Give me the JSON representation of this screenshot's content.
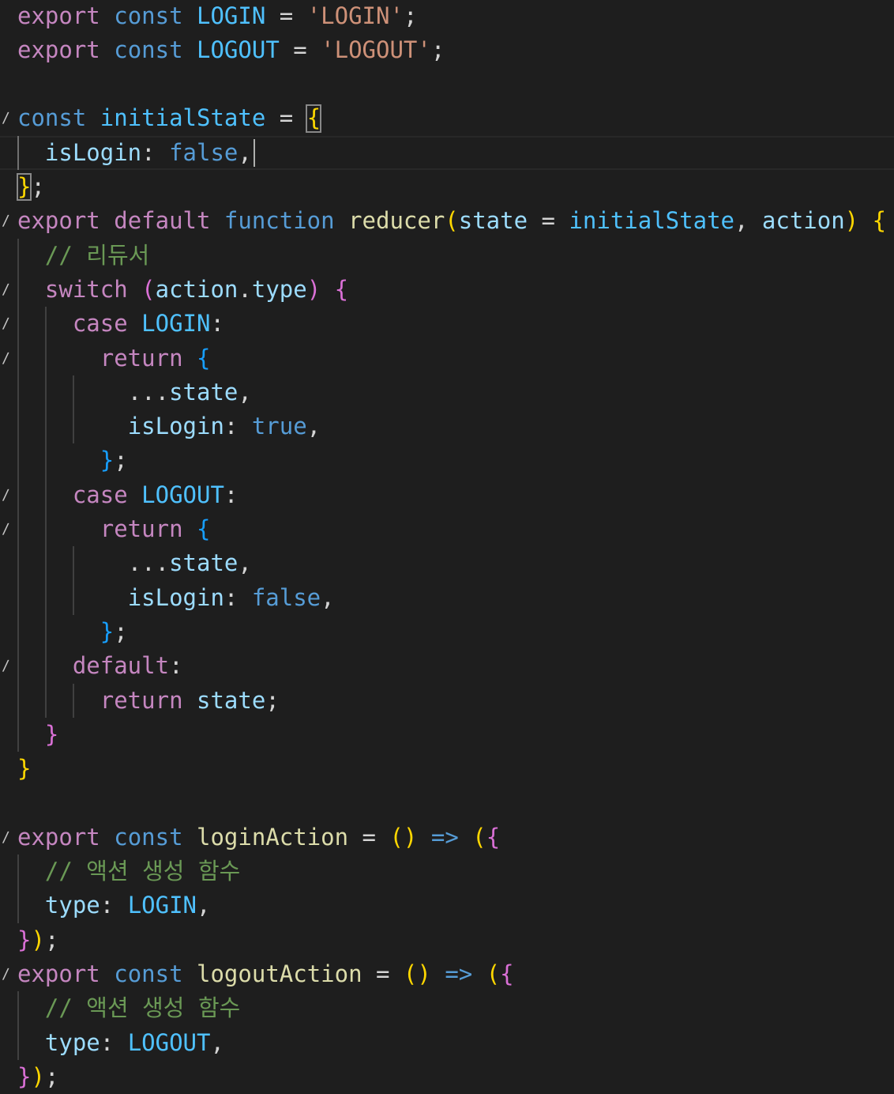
{
  "editor": {
    "theme_colors": {
      "background": "#1e1e1e",
      "keyword": "#569cd6",
      "control": "#c586c0",
      "variable": "#9cdcfe",
      "constant": "#4fc1ff",
      "function": "#dcdcaa",
      "string": "#ce9178",
      "comment": "#6a9955",
      "bracket_level_1": "#ffd700",
      "bracket_level_2": "#da70d6",
      "bracket_level_3": "#179fff"
    },
    "lines": [
      {
        "fold": false,
        "tokens": [
          {
            "t": "export",
            "c": "t-ctl"
          },
          {
            "t": " ",
            "c": ""
          },
          {
            "t": "const",
            "c": "t-kw"
          },
          {
            "t": " ",
            "c": ""
          },
          {
            "t": "LOGIN",
            "c": "t-const"
          },
          {
            "t": " = ",
            "c": ""
          },
          {
            "t": "'LOGIN'",
            "c": "t-str"
          },
          {
            "t": ";",
            "c": ""
          }
        ]
      },
      {
        "fold": false,
        "tokens": [
          {
            "t": "export",
            "c": "t-ctl"
          },
          {
            "t": " ",
            "c": ""
          },
          {
            "t": "const",
            "c": "t-kw"
          },
          {
            "t": " ",
            "c": ""
          },
          {
            "t": "LOGOUT",
            "c": "t-const"
          },
          {
            "t": " = ",
            "c": ""
          },
          {
            "t": "'LOGOUT'",
            "c": "t-str"
          },
          {
            "t": ";",
            "c": ""
          }
        ]
      },
      {
        "fold": false,
        "tokens": []
      },
      {
        "fold": true,
        "tokens": [
          {
            "t": "const",
            "c": "t-kw"
          },
          {
            "t": " ",
            "c": ""
          },
          {
            "t": "initialState",
            "c": "t-const"
          },
          {
            "t": " = ",
            "c": ""
          },
          {
            "t": "{",
            "c": "t-b1"
          }
        ]
      },
      {
        "fold": false,
        "tokens": [
          {
            "t": "  ",
            "c": ""
          },
          {
            "t": "isLogin",
            "c": "t-var"
          },
          {
            "t": ": ",
            "c": ""
          },
          {
            "t": "false",
            "c": "t-kw"
          },
          {
            "t": ",",
            "c": ""
          }
        ]
      },
      {
        "fold": false,
        "tokens": [
          {
            "t": "}",
            "c": "t-b1"
          },
          {
            "t": ";",
            "c": ""
          }
        ]
      },
      {
        "fold": true,
        "tokens": [
          {
            "t": "export",
            "c": "t-ctl"
          },
          {
            "t": " ",
            "c": ""
          },
          {
            "t": "default",
            "c": "t-ctl"
          },
          {
            "t": " ",
            "c": ""
          },
          {
            "t": "function",
            "c": "t-kw"
          },
          {
            "t": " ",
            "c": ""
          },
          {
            "t": "reducer",
            "c": "t-fn"
          },
          {
            "t": "(",
            "c": "t-b1"
          },
          {
            "t": "state",
            "c": "t-var"
          },
          {
            "t": " = ",
            "c": ""
          },
          {
            "t": "initialState",
            "c": "t-const"
          },
          {
            "t": ", ",
            "c": ""
          },
          {
            "t": "action",
            "c": "t-var"
          },
          {
            "t": ")",
            "c": "t-b1"
          },
          {
            "t": " ",
            "c": ""
          },
          {
            "t": "{",
            "c": "t-b1"
          }
        ]
      },
      {
        "fold": false,
        "tokens": [
          {
            "t": "  ",
            "c": ""
          },
          {
            "t": "// 리듀서",
            "c": "t-cm"
          }
        ]
      },
      {
        "fold": true,
        "tokens": [
          {
            "t": "  ",
            "c": ""
          },
          {
            "t": "switch",
            "c": "t-ctl"
          },
          {
            "t": " ",
            "c": ""
          },
          {
            "t": "(",
            "c": "t-b2"
          },
          {
            "t": "action",
            "c": "t-var"
          },
          {
            "t": ".",
            "c": ""
          },
          {
            "t": "type",
            "c": "t-var"
          },
          {
            "t": ")",
            "c": "t-b2"
          },
          {
            "t": " ",
            "c": ""
          },
          {
            "t": "{",
            "c": "t-b2"
          }
        ]
      },
      {
        "fold": true,
        "tokens": [
          {
            "t": "    ",
            "c": ""
          },
          {
            "t": "case",
            "c": "t-ctl"
          },
          {
            "t": " ",
            "c": ""
          },
          {
            "t": "LOGIN",
            "c": "t-const"
          },
          {
            "t": ":",
            "c": ""
          }
        ]
      },
      {
        "fold": true,
        "tokens": [
          {
            "t": "      ",
            "c": ""
          },
          {
            "t": "return",
            "c": "t-ctl"
          },
          {
            "t": " ",
            "c": ""
          },
          {
            "t": "{",
            "c": "t-b3"
          }
        ]
      },
      {
        "fold": false,
        "tokens": [
          {
            "t": "        ",
            "c": ""
          },
          {
            "t": "...",
            "c": ""
          },
          {
            "t": "state",
            "c": "t-var"
          },
          {
            "t": ",",
            "c": ""
          }
        ]
      },
      {
        "fold": false,
        "tokens": [
          {
            "t": "        ",
            "c": ""
          },
          {
            "t": "isLogin",
            "c": "t-var"
          },
          {
            "t": ": ",
            "c": ""
          },
          {
            "t": "true",
            "c": "t-kw"
          },
          {
            "t": ",",
            "c": ""
          }
        ]
      },
      {
        "fold": false,
        "tokens": [
          {
            "t": "      ",
            "c": ""
          },
          {
            "t": "}",
            "c": "t-b3"
          },
          {
            "t": ";",
            "c": ""
          }
        ]
      },
      {
        "fold": true,
        "tokens": [
          {
            "t": "    ",
            "c": ""
          },
          {
            "t": "case",
            "c": "t-ctl"
          },
          {
            "t": " ",
            "c": ""
          },
          {
            "t": "LOGOUT",
            "c": "t-const"
          },
          {
            "t": ":",
            "c": ""
          }
        ]
      },
      {
        "fold": true,
        "tokens": [
          {
            "t": "      ",
            "c": ""
          },
          {
            "t": "return",
            "c": "t-ctl"
          },
          {
            "t": " ",
            "c": ""
          },
          {
            "t": "{",
            "c": "t-b3"
          }
        ]
      },
      {
        "fold": false,
        "tokens": [
          {
            "t": "        ",
            "c": ""
          },
          {
            "t": "...",
            "c": ""
          },
          {
            "t": "state",
            "c": "t-var"
          },
          {
            "t": ",",
            "c": ""
          }
        ]
      },
      {
        "fold": false,
        "tokens": [
          {
            "t": "        ",
            "c": ""
          },
          {
            "t": "isLogin",
            "c": "t-var"
          },
          {
            "t": ": ",
            "c": ""
          },
          {
            "t": "false",
            "c": "t-kw"
          },
          {
            "t": ",",
            "c": ""
          }
        ]
      },
      {
        "fold": false,
        "tokens": [
          {
            "t": "      ",
            "c": ""
          },
          {
            "t": "}",
            "c": "t-b3"
          },
          {
            "t": ";",
            "c": ""
          }
        ]
      },
      {
        "fold": true,
        "tokens": [
          {
            "t": "    ",
            "c": ""
          },
          {
            "t": "default",
            "c": "t-ctl"
          },
          {
            "t": ":",
            "c": ""
          }
        ]
      },
      {
        "fold": false,
        "tokens": [
          {
            "t": "      ",
            "c": ""
          },
          {
            "t": "return",
            "c": "t-ctl"
          },
          {
            "t": " ",
            "c": ""
          },
          {
            "t": "state",
            "c": "t-var"
          },
          {
            "t": ";",
            "c": ""
          }
        ]
      },
      {
        "fold": false,
        "tokens": [
          {
            "t": "  ",
            "c": ""
          },
          {
            "t": "}",
            "c": "t-b2"
          }
        ]
      },
      {
        "fold": false,
        "tokens": [
          {
            "t": "}",
            "c": "t-b1"
          }
        ]
      },
      {
        "fold": false,
        "tokens": []
      },
      {
        "fold": true,
        "tokens": [
          {
            "t": "export",
            "c": "t-ctl"
          },
          {
            "t": " ",
            "c": ""
          },
          {
            "t": "const",
            "c": "t-kw"
          },
          {
            "t": " ",
            "c": ""
          },
          {
            "t": "loginAction",
            "c": "t-fn"
          },
          {
            "t": " = ",
            "c": ""
          },
          {
            "t": "()",
            "c": "t-b1"
          },
          {
            "t": " ",
            "c": ""
          },
          {
            "t": "=>",
            "c": "t-kw"
          },
          {
            "t": " ",
            "c": ""
          },
          {
            "t": "(",
            "c": "t-b1"
          },
          {
            "t": "{",
            "c": "t-b2"
          }
        ]
      },
      {
        "fold": false,
        "tokens": [
          {
            "t": "  ",
            "c": ""
          },
          {
            "t": "// 액션 생성 함수",
            "c": "t-cm"
          }
        ]
      },
      {
        "fold": false,
        "tokens": [
          {
            "t": "  ",
            "c": ""
          },
          {
            "t": "type",
            "c": "t-var"
          },
          {
            "t": ": ",
            "c": ""
          },
          {
            "t": "LOGIN",
            "c": "t-const"
          },
          {
            "t": ",",
            "c": ""
          }
        ]
      },
      {
        "fold": false,
        "tokens": [
          {
            "t": "}",
            "c": "t-b2"
          },
          {
            "t": ")",
            "c": "t-b1"
          },
          {
            "t": ";",
            "c": ""
          }
        ]
      },
      {
        "fold": true,
        "tokens": [
          {
            "t": "export",
            "c": "t-ctl"
          },
          {
            "t": " ",
            "c": ""
          },
          {
            "t": "const",
            "c": "t-kw"
          },
          {
            "t": " ",
            "c": ""
          },
          {
            "t": "logoutAction",
            "c": "t-fn"
          },
          {
            "t": " = ",
            "c": ""
          },
          {
            "t": "()",
            "c": "t-b1"
          },
          {
            "t": " ",
            "c": ""
          },
          {
            "t": "=>",
            "c": "t-kw"
          },
          {
            "t": " ",
            "c": ""
          },
          {
            "t": "(",
            "c": "t-b1"
          },
          {
            "t": "{",
            "c": "t-b2"
          }
        ]
      },
      {
        "fold": false,
        "tokens": [
          {
            "t": "  ",
            "c": ""
          },
          {
            "t": "// 액션 생성 함수",
            "c": "t-cm"
          }
        ]
      },
      {
        "fold": false,
        "tokens": [
          {
            "t": "  ",
            "c": ""
          },
          {
            "t": "type",
            "c": "t-var"
          },
          {
            "t": ": ",
            "c": ""
          },
          {
            "t": "LOGOUT",
            "c": "t-const"
          },
          {
            "t": ",",
            "c": ""
          }
        ]
      },
      {
        "fold": false,
        "tokens": [
          {
            "t": "}",
            "c": "t-b2"
          },
          {
            "t": ")",
            "c": "t-b1"
          },
          {
            "t": ";",
            "c": ""
          }
        ]
      }
    ]
  }
}
